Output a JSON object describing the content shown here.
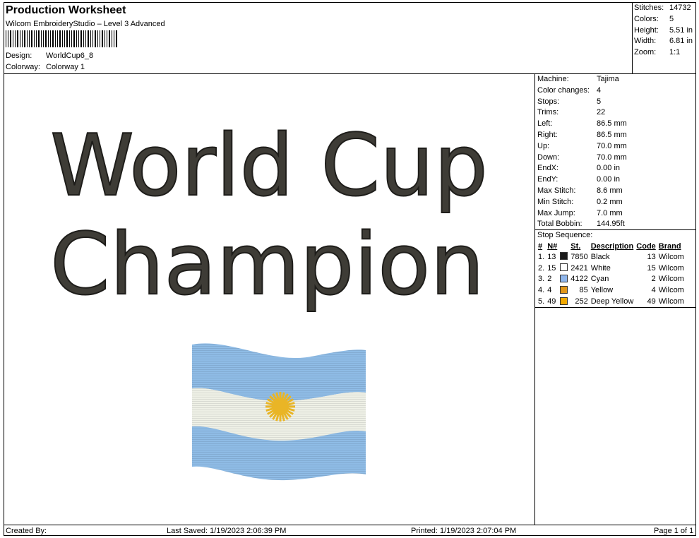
{
  "header": {
    "title": "Production Worksheet",
    "software": "Wilcom EmbroideryStudio – Level 3 Advanced",
    "design_label": "Design:",
    "design_value": "WorldCup6_8",
    "colorway_label": "Colorway:",
    "colorway_value": "Colorway 1"
  },
  "summary": [
    {
      "label": "Stitches:",
      "value": "14732"
    },
    {
      "label": "Colors:",
      "value": "5"
    },
    {
      "label": "Height:",
      "value": "5.51 in"
    },
    {
      "label": "Width:",
      "value": "6.81 in"
    },
    {
      "label": "Zoom:",
      "value": "1:1"
    }
  ],
  "machine_info": [
    {
      "label": "Machine:",
      "value": "Tajima"
    },
    {
      "label": "Color changes:",
      "value": "4"
    },
    {
      "label": "Stops:",
      "value": "5"
    },
    {
      "label": "Trims:",
      "value": "22"
    },
    {
      "label": "Left:",
      "value": "86.5 mm"
    },
    {
      "label": "Right:",
      "value": "86.5 mm"
    },
    {
      "label": "Up:",
      "value": "70.0 mm"
    },
    {
      "label": "Down:",
      "value": "70.0 mm"
    },
    {
      "label": "EndX:",
      "value": "0.00 in"
    },
    {
      "label": "EndY:",
      "value": "0.00 in"
    },
    {
      "label": "Max Stitch:",
      "value": "8.6 mm"
    },
    {
      "label": "Min Stitch:",
      "value": "0.2 mm"
    },
    {
      "label": "Max Jump:",
      "value": "7.0 mm"
    },
    {
      "label": "Total Bobbin:",
      "value": "144.95ft"
    }
  ],
  "stop_sequence": {
    "title": "Stop Sequence:",
    "columns": [
      "#",
      "N#",
      "St.",
      "Description",
      "Code",
      "Brand"
    ],
    "rows": [
      {
        "num": "1.",
        "n": "13",
        "color": "#1a1a1a",
        "st": "7850",
        "desc": "Black",
        "code": "13",
        "brand": "Wilcom"
      },
      {
        "num": "2.",
        "n": "15",
        "color": "#ffffff",
        "st": "2421",
        "desc": "White",
        "code": "15",
        "brand": "Wilcom"
      },
      {
        "num": "3.",
        "n": "2",
        "color": "#8fb6ec",
        "st": "4122",
        "desc": "Cyan",
        "code": "2",
        "brand": "Wilcom"
      },
      {
        "num": "4.",
        "n": "4",
        "color": "#e0961a",
        "st": "85",
        "desc": "Yellow",
        "code": "4",
        "brand": "Wilcom"
      },
      {
        "num": "5.",
        "n": "49",
        "color": "#f2a900",
        "st": "252",
        "desc": "Deep Yellow",
        "code": "49",
        "brand": "Wilcom"
      }
    ]
  },
  "design": {
    "line1": "World Cup",
    "line2": "Champion",
    "text_color": "#3e3c36",
    "flag_blue": "#8fbce6",
    "flag_white": "#eef0e6",
    "sun_color": "#e9b526"
  },
  "footer": {
    "created_by": "Created By:",
    "last_saved": "Last Saved: 1/19/2023 2:06:39 PM",
    "printed": "Printed: 1/19/2023 2:07:04 PM",
    "page": "Page 1 of 1"
  }
}
